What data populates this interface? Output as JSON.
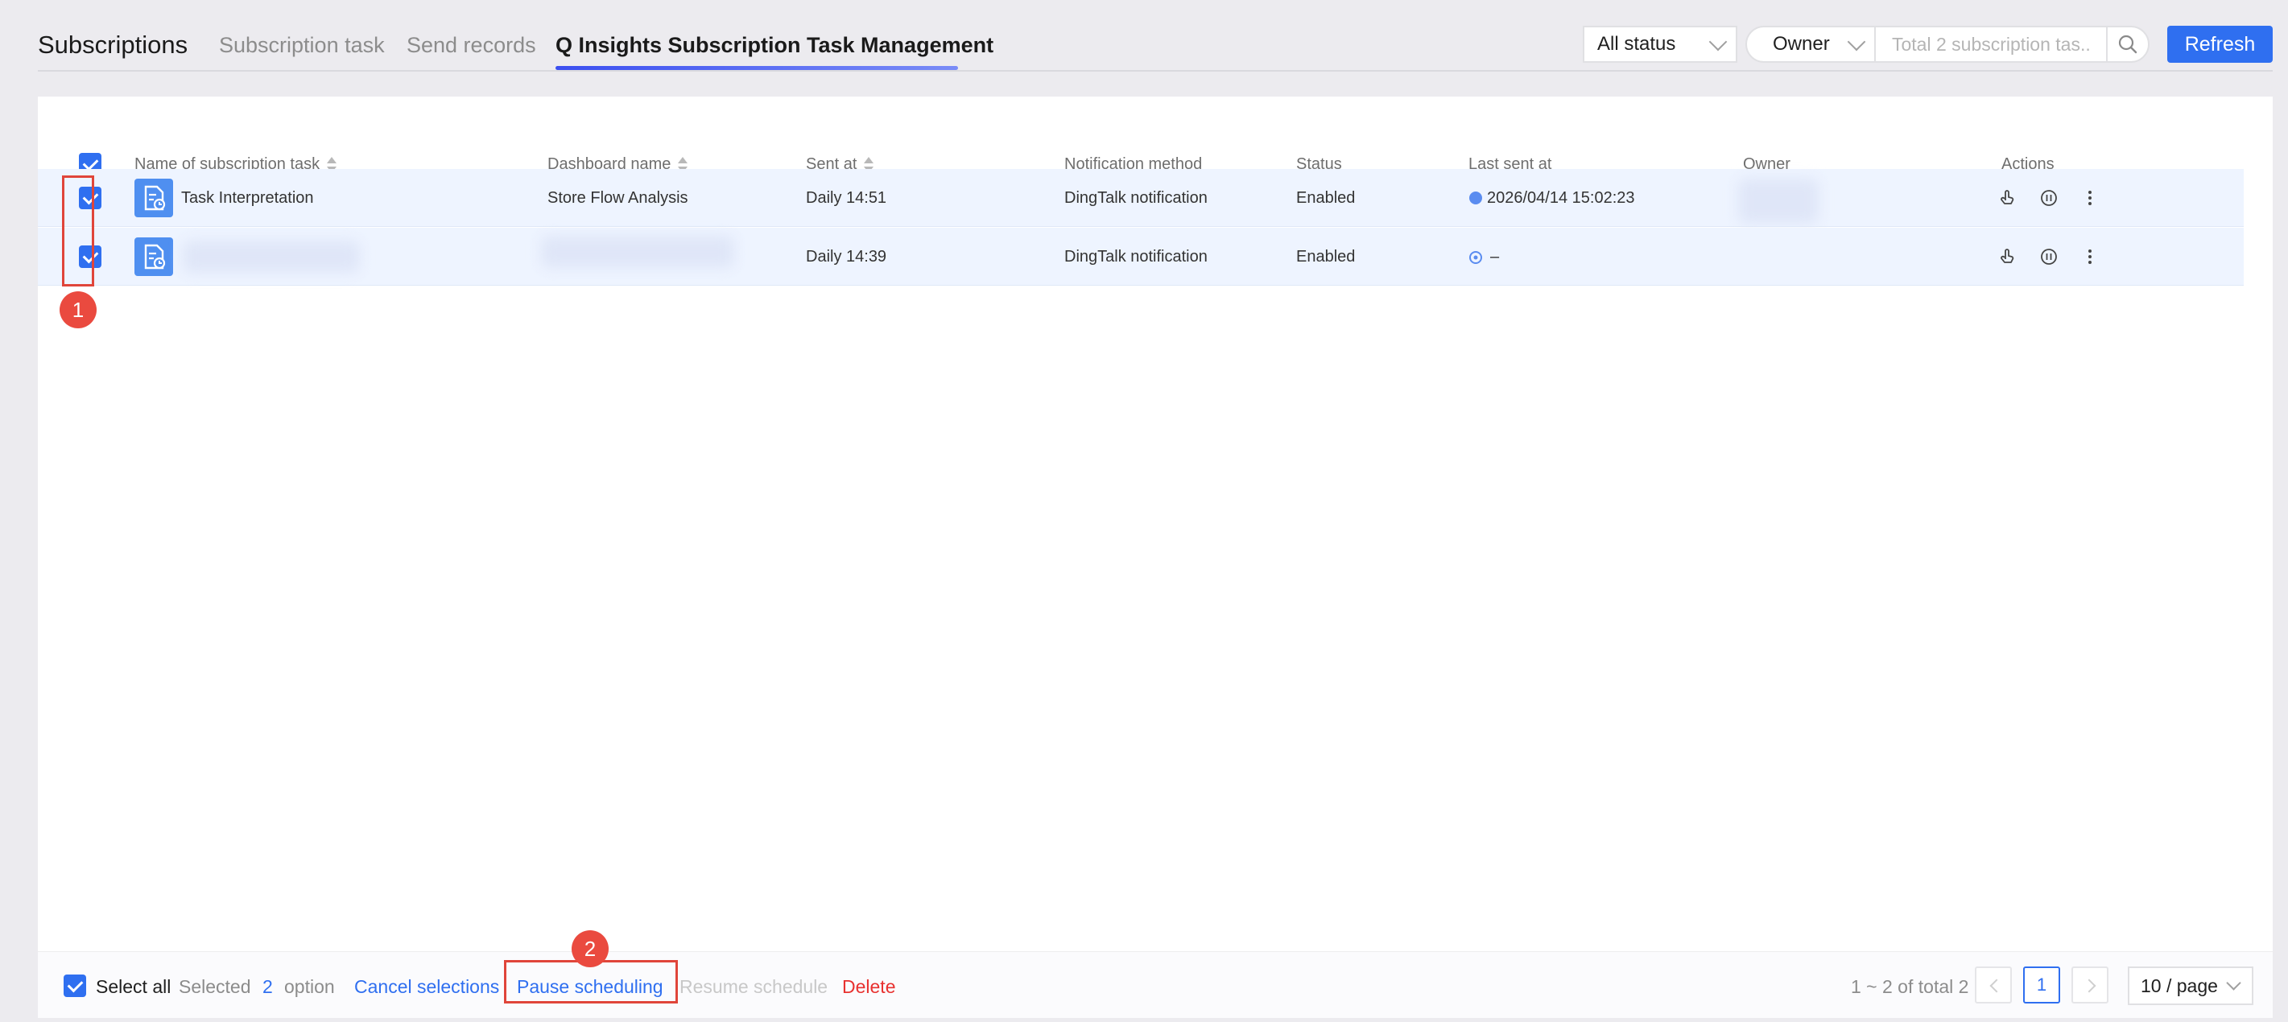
{
  "header": {
    "brand": "Subscriptions",
    "tabs": [
      {
        "label": "Subscription task"
      },
      {
        "label": "Send records"
      },
      {
        "label": "Q Insights Subscription Task Management"
      }
    ],
    "status_filter": "All status",
    "owner_filter": "Owner",
    "search_placeholder": "Total 2 subscription tas...",
    "refresh_label": "Refresh"
  },
  "table": {
    "columns": [
      "Name of subscription task",
      "Dashboard name",
      "Sent at",
      "Notification method",
      "Status",
      "Last sent at",
      "Owner",
      "Actions"
    ],
    "rows": [
      {
        "name": "Task Interpretation",
        "dashboard": "Store Flow Analysis",
        "sent_at": "Daily 14:51",
        "method": "DingTalk notification",
        "status": "Enabled",
        "last_sent": "2026/04/14 15:02:23"
      },
      {
        "name": "",
        "dashboard": "",
        "sent_at": "Daily 14:39",
        "method": "DingTalk notification",
        "status": "Enabled",
        "last_sent": "–"
      }
    ]
  },
  "footer": {
    "select_all": "Select all",
    "selected_prefix": "Selected",
    "selected_count": "2",
    "selected_suffix": "option",
    "cancel": "Cancel selections",
    "pause": "Pause scheduling",
    "resume": "Resume schedule",
    "delete": "Delete",
    "range": "1 ~ 2 of total 2",
    "current_page": "1",
    "page_size": "10 / page"
  },
  "annotations": {
    "badge_1": "1",
    "badge_2": "2"
  },
  "colors": {
    "accent": "#2f6ff0",
    "danger": "#e8312f",
    "selected_row": "#eef4ff",
    "annotation": "#e0453a"
  }
}
